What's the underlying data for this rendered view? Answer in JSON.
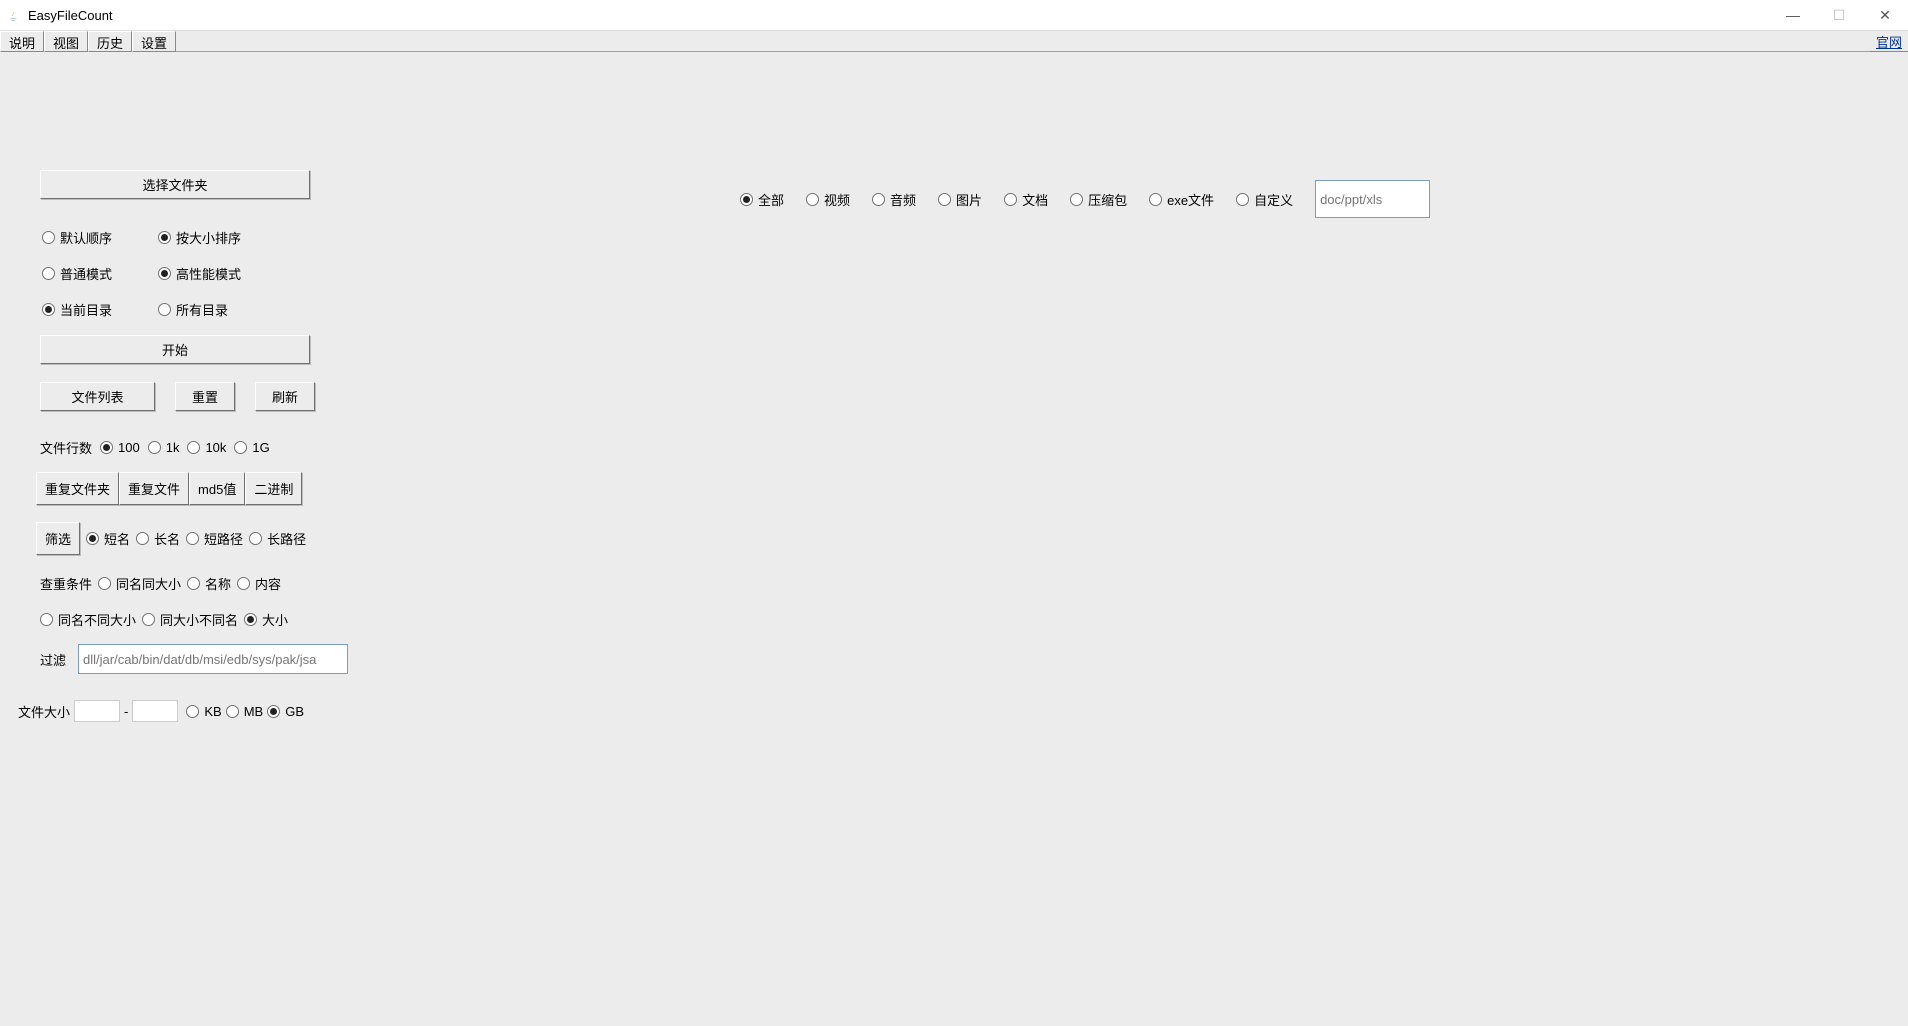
{
  "window": {
    "title": "EasyFileCount"
  },
  "menu": {
    "items": [
      "说明",
      "视图",
      "历史",
      "设置"
    ],
    "official_site": "官网"
  },
  "filetypes": {
    "all": "全部",
    "video": "视频",
    "audio": "音频",
    "image": "图片",
    "doc": "文档",
    "archive": "压缩包",
    "exe": "exe文件",
    "custom": "自定义",
    "custom_placeholder": "doc/ppt/xls",
    "selected": "all"
  },
  "buttons": {
    "choose_folder": "选择文件夹",
    "start": "开始",
    "file_list": "文件列表",
    "reset": "重置",
    "refresh": "刷新",
    "dup_folder": "重复文件夹",
    "dup_file": "重复文件",
    "md5": "md5值",
    "binary": "二进制",
    "filter_btn": "筛选"
  },
  "sort": {
    "default": "默认顺序",
    "size": "按大小排序",
    "selected": "size"
  },
  "mode": {
    "normal": "普通模式",
    "high_perf": "高性能模式",
    "selected": "high_perf"
  },
  "scope": {
    "current": "当前目录",
    "all": "所有目录",
    "selected": "current"
  },
  "filelines": {
    "label": "文件行数",
    "v100": "100",
    "v1k": "1k",
    "v10k": "10k",
    "v1g": "1G",
    "selected": "v100"
  },
  "namefilter": {
    "short_name": "短名",
    "long_name": "长名",
    "short_path": "短路径",
    "long_path": "长路径",
    "selected": "short_name"
  },
  "dupcond": {
    "label": "查重条件",
    "same_name_size": "同名同大小",
    "name": "名称",
    "content": "内容",
    "same_name_diff_size": "同名不同大小",
    "same_size_diff_name": "同大小不同名",
    "size": "大小",
    "selected": "size"
  },
  "filter": {
    "label": "过滤",
    "placeholder": "dll/jar/cab/bin/dat/db/msi/edb/sys/pak/jsa"
  },
  "filesize": {
    "label": "文件大小",
    "sep": "-",
    "kb": "KB",
    "mb": "MB",
    "gb": "GB",
    "selected": "gb",
    "min": "",
    "max": ""
  }
}
